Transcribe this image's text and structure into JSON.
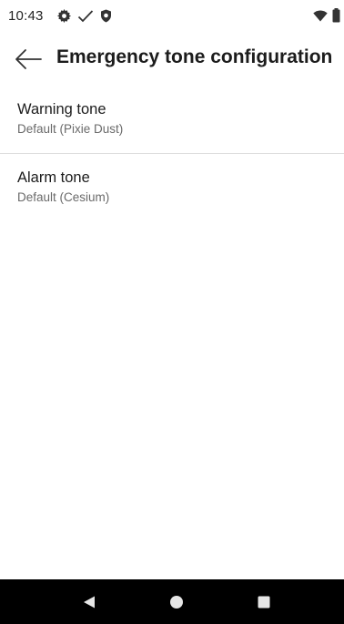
{
  "status_bar": {
    "time": "10:43",
    "icons": [
      "gear-icon",
      "check-icon",
      "shield-icon",
      "wifi-icon",
      "battery-icon"
    ]
  },
  "app_bar": {
    "back_icon": "arrow-left-icon",
    "title": "Emergency tone configuration"
  },
  "preferences": [
    {
      "title": "Warning tone",
      "summary": "Default (Pixie Dust)"
    },
    {
      "title": "Alarm tone",
      "summary": "Default (Cesium)"
    }
  ],
  "nav_bar": {
    "buttons": [
      "back-triangle-icon",
      "home-circle-icon",
      "recents-square-icon"
    ]
  },
  "colors": {
    "background": "#ffffff",
    "text_primary": "#1c1c1c",
    "text_secondary": "#6a6a6a",
    "divider": "#dedede",
    "nav_bar": "#000000",
    "nav_icon": "#e6e6e6"
  }
}
